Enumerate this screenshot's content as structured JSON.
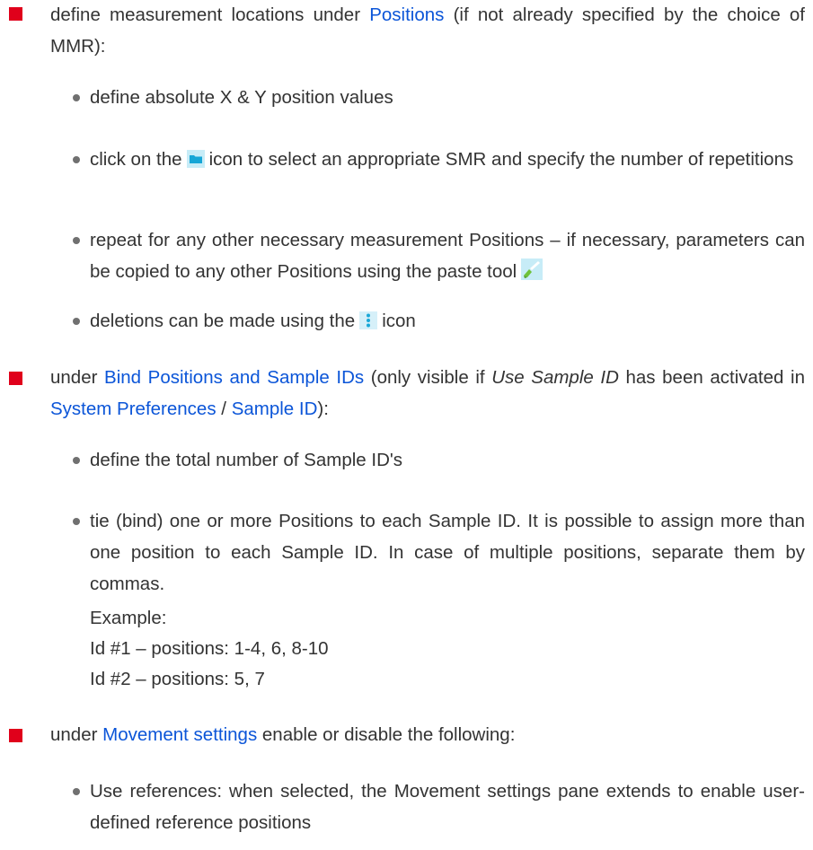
{
  "b1": {
    "pre": "define measurement locations under",
    "link": "Positions",
    "post": "(if not already specified by the choice of MMR):",
    "items": {
      "a": "define absolute X & Y position values",
      "b_pre": "click on the",
      "b_post": "icon to select an appropriate SMR and specify the number of repetitions",
      "c": "repeat for any other necessary measurement Positions – if necessary, parameters can be copied to any other Positions using the paste tool",
      "d_pre": "deletions can be made using the",
      "d_post": "icon"
    }
  },
  "b2": {
    "pre": "under",
    "link1": "Bind Positions and Sample IDs",
    "mid1": "(only visible if",
    "em": "Use Sample ID",
    "mid2": "has been activated in",
    "link2": "System Preferences",
    "sep": "/",
    "link3": "Sample ID",
    "post": "):",
    "items": {
      "a": "define the total number of Sample ID's",
      "b": "tie (bind) one or more Positions to each Sample ID. It is possible to assign more than one position to each Sample ID. In case of multiple positions, separate them by commas."
    },
    "example_label": "Example:",
    "example_line1": "Id #1 – positions: 1-4, 6, 8-10",
    "example_line2": "Id #2 – positions: 5, 7"
  },
  "b3": {
    "pre": "under",
    "link": "Movement settings",
    "post": "enable or disable the following:",
    "items": {
      "a": "Use references: when selected, the Movement settings pane extends to enable user-defined reference positions"
    }
  },
  "icons": {
    "folder": "folder-icon",
    "paste": "paste-brush-icon",
    "more": "vertical-dots-icon"
  },
  "colors": {
    "link": "#0b55d8",
    "bullet_square": "#e0001b",
    "icon_cyan": "#3ec0e8"
  }
}
